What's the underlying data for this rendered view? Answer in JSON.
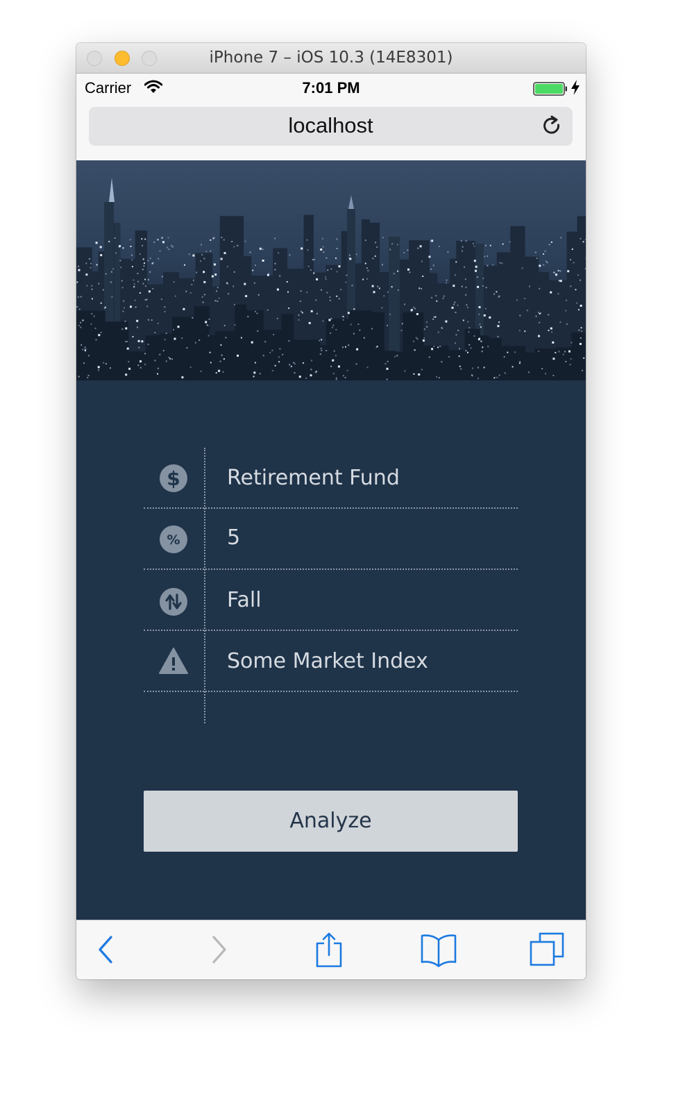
{
  "window": {
    "title": "iPhone 7 – iOS 10.3 (14E8301)"
  },
  "status_bar": {
    "carrier": "Carrier",
    "time": "7:01 PM",
    "battery_level": 1.0
  },
  "address_bar": {
    "url": "localhost"
  },
  "form": {
    "fields": [
      {
        "icon": "dollar-icon",
        "value": "Retirement Fund"
      },
      {
        "icon": "percent-icon",
        "value": "5"
      },
      {
        "icon": "up-down-arrows-icon",
        "value": "Fall"
      },
      {
        "icon": "warning-icon",
        "value": "Some Market Index"
      }
    ],
    "submit_label": "Analyze"
  },
  "toolbar": {
    "items": [
      "back-icon",
      "forward-icon",
      "share-icon",
      "bookmarks-icon",
      "tabs-icon"
    ]
  },
  "colors": {
    "content_background": "#1f3349",
    "button_background": "#d0d5da",
    "text_light": "#d6dbe1",
    "ios_blue": "#1c7ae0",
    "battery_green": "#4cd964",
    "traffic_minimize": "#fdbc2e"
  }
}
